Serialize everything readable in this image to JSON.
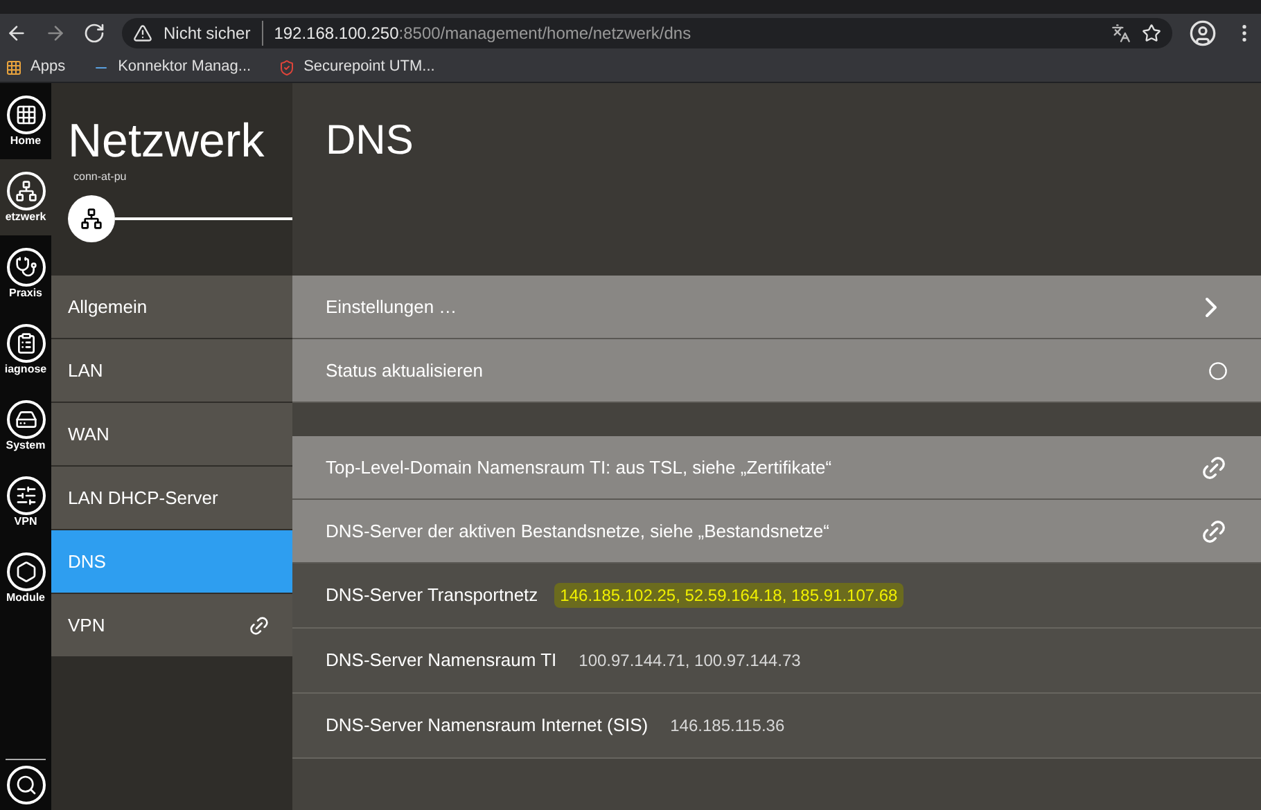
{
  "browser": {
    "security": "Nicht sicher",
    "url_host": "192.168.100.250",
    "url_rest": ":8500/management/home/netzwerk/dns",
    "bookmarks": [
      {
        "kind": "apps",
        "label": "Apps"
      },
      {
        "kind": "page",
        "label": "Konnektor Manag..."
      },
      {
        "kind": "shield",
        "label": "Securepoint UTM..."
      }
    ]
  },
  "rail": [
    {
      "kind": "grid",
      "label": "Home",
      "selected": false
    },
    {
      "kind": "network",
      "label": "etzwerk",
      "selected": true
    },
    {
      "kind": "staff",
      "label": "Praxis",
      "selected": false
    },
    {
      "kind": "clipboard",
      "label": "iagnose",
      "selected": false
    },
    {
      "kind": "device",
      "label": "System",
      "selected": false
    },
    {
      "kind": "sliders",
      "label": "VPN",
      "selected": false
    },
    {
      "kind": "hexagons",
      "label": "Module",
      "selected": false
    }
  ],
  "nav": {
    "title": "Netzwerk",
    "subtitle": "conn-at-pu",
    "items": [
      {
        "label": "Allgemein",
        "selected": false,
        "link": false
      },
      {
        "label": "LAN",
        "selected": false,
        "link": false
      },
      {
        "label": "WAN",
        "selected": false,
        "link": false
      },
      {
        "label": "LAN DHCP-Server",
        "selected": false,
        "link": false
      },
      {
        "label": "DNS",
        "selected": true,
        "link": false
      },
      {
        "label": "VPN",
        "selected": false,
        "link": true
      }
    ]
  },
  "main": {
    "title": "DNS",
    "actions": [
      {
        "kind": "chevron",
        "label": "Einstellungen …"
      },
      {
        "kind": "circle",
        "label": "Status aktualisieren"
      }
    ],
    "links": [
      "Top-Level-Domain Namensraum TI: aus TSL, siehe „Zertifikate“",
      "DNS-Server der aktiven Bestandsnetze, siehe „Bestandsnetze“"
    ],
    "values": [
      {
        "label": "DNS-Server Transportnetz",
        "value": "146.185.102.25, 52.59.164.18, 185.91.107.68",
        "highlighted": true
      },
      {
        "label": "DNS-Server Namensraum TI",
        "value": "100.97.144.71, 100.97.144.73",
        "highlighted": false
      },
      {
        "label": "DNS-Server Namensraum Internet (SIS)",
        "value": "146.185.115.36",
        "highlighted": false
      }
    ]
  }
}
